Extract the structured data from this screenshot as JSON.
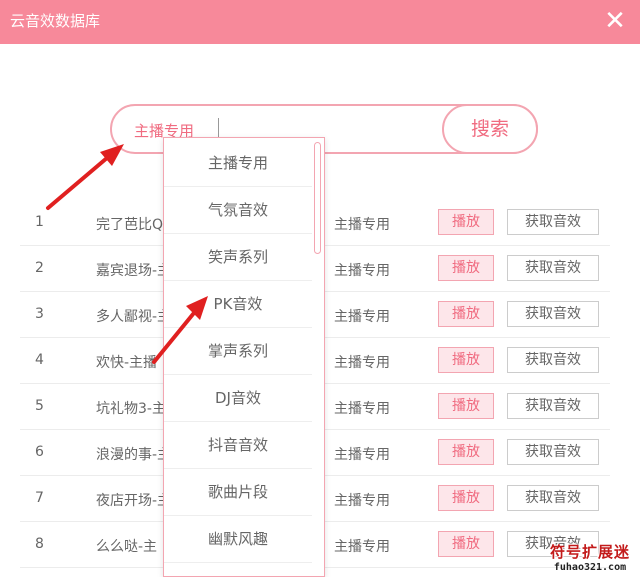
{
  "window": {
    "title": "云音效数据库",
    "close_icon": "close-icon"
  },
  "colors": {
    "titlebar": "#f7899a",
    "accent": "#f06b80",
    "accent_border": "#f3a5b1",
    "arrow": "#e02020"
  },
  "search": {
    "category_selected": "主播专用",
    "value": "",
    "button_label": "搜索"
  },
  "dropdown": {
    "options": [
      "主播专用",
      "气氛音效",
      "笑声系列",
      "PK音效",
      "掌声系列",
      "DJ音效",
      "抖音音效",
      "歌曲片段",
      "幽默风趣"
    ]
  },
  "table": {
    "rows": [
      {
        "num": "1",
        "name": "完了芭比Q",
        "category": "主播专用",
        "play": "播放",
        "get": "获取音效"
      },
      {
        "num": "2",
        "name": "嘉宾退场-主",
        "category": "主播专用",
        "play": "播放",
        "get": "获取音效"
      },
      {
        "num": "3",
        "name": "多人鄙视-主",
        "category": "主播专用",
        "play": "播放",
        "get": "获取音效"
      },
      {
        "num": "4",
        "name": "欢快-主播",
        "category": "主播专用",
        "play": "播放",
        "get": "获取音效"
      },
      {
        "num": "5",
        "name": "坑礼物3-主",
        "category": "主播专用",
        "play": "播放",
        "get": "获取音效"
      },
      {
        "num": "6",
        "name": "浪漫的事-主",
        "category": "主播专用",
        "play": "播放",
        "get": "获取音效"
      },
      {
        "num": "7",
        "name": "夜店开场-主",
        "category": "主播专用",
        "play": "播放",
        "get": "获取音效"
      },
      {
        "num": "8",
        "name": "么么哒-主",
        "category": "主播专用",
        "play": "播放",
        "get": "获取音效"
      }
    ]
  },
  "watermark": {
    "brand": "符号扩展迷",
    "domain": "fuhao321.com"
  }
}
